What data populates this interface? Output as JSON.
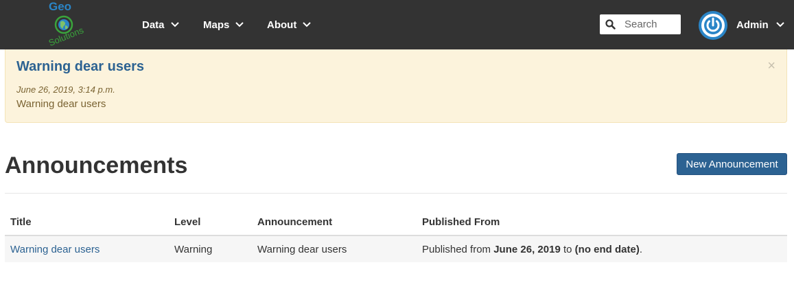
{
  "brand": {
    "logo_top": "Geo",
    "logo_bottom": "Solutions"
  },
  "nav": {
    "items": [
      {
        "label": "Data"
      },
      {
        "label": "Maps"
      },
      {
        "label": "About"
      }
    ],
    "search_placeholder": "Search",
    "user_label": "Admin"
  },
  "alert": {
    "title": "Warning dear users",
    "date": "June 26, 2019, 3:14 p.m.",
    "body": "Warning dear users",
    "close": "×"
  },
  "page": {
    "title": "Announcements",
    "new_button": "New Announcement"
  },
  "table": {
    "headers": [
      "Title",
      "Level",
      "Announcement",
      "Published From"
    ],
    "rows": [
      {
        "title": "Warning dear users",
        "level": "Warning",
        "announcement": "Warning dear users",
        "published": {
          "prefix": "Published from ",
          "start": "June 26, 2019",
          "middle": " to ",
          "end": "(no end date)",
          "suffix": "."
        }
      }
    ]
  },
  "colors": {
    "navbar": "#333333",
    "accent": "#2c6292",
    "alert_bg": "#fcf3dc",
    "alert_text": "#7a6332",
    "logo_green": "#3aa43c",
    "logo_blue": "#2a85c7"
  }
}
